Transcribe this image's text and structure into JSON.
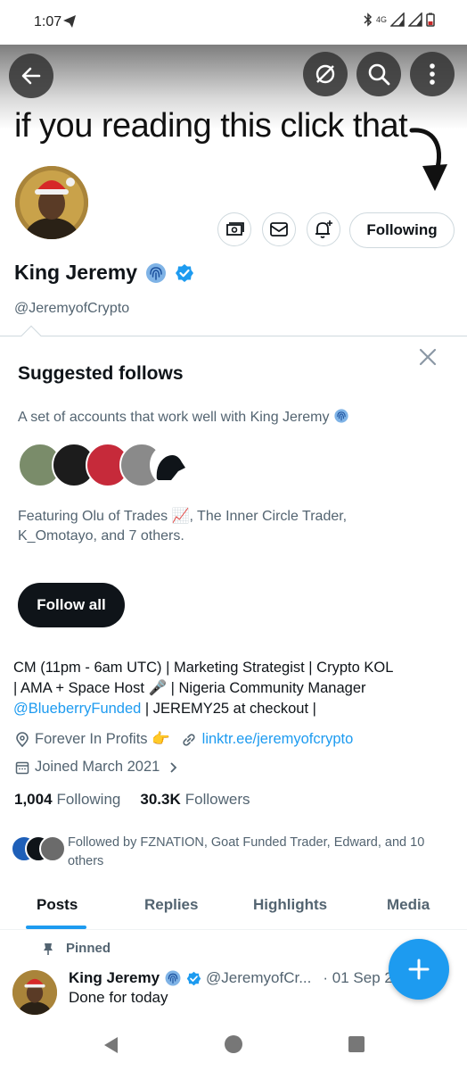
{
  "status_bar": {
    "time": "1:07",
    "network": "4G"
  },
  "banner": {
    "text": "if you reading this click that"
  },
  "header_buttons": {
    "back": "back-icon",
    "mute": "no-notify-icon",
    "search": "search-icon",
    "more": "more-icon"
  },
  "profile": {
    "name": "King Jeremy",
    "handle": "@JeremyofCrypto",
    "following_button": "Following"
  },
  "suggested": {
    "title": "Suggested follows",
    "subtitle": "A set of accounts that work well with King Jeremy",
    "featuring": "Featuring Olu of Trades 📈, The Inner Circle Trader, K_Omotayo, and 7 others.",
    "follow_all": "Follow all"
  },
  "bio": {
    "line1": "CM (11pm - 6am UTC) | Marketing Strategist | Crypto KOL",
    "line2": "| AMA + Space Host 🎤 | Nigeria Community Manager",
    "mention": "@BlueberryFunded",
    "line3_rest": " | JEREMY25 at checkout |"
  },
  "meta": {
    "location": "Forever In Profits 👉",
    "website": "linktr.ee/jeremyofcrypto",
    "joined": "Joined March 2021"
  },
  "stats": {
    "following_count": "1,004",
    "following_label": "Following",
    "followers_count": "30.3K",
    "followers_label": "Followers"
  },
  "followed_by": "Followed by FZNATION, Goat Funded Trader, Edward, and 10 others",
  "tabs": [
    "Posts",
    "Replies",
    "Highlights",
    "Media"
  ],
  "post": {
    "pinned_label": "Pinned",
    "author": "King Jeremy",
    "handle": "@JeremyofCr...",
    "date": "· 01 Sep 25",
    "text": "Done for today"
  },
  "colors": {
    "accent": "#1d9bf0",
    "text": "#0f1419",
    "muted": "#536471",
    "border": "#cfd9de"
  }
}
